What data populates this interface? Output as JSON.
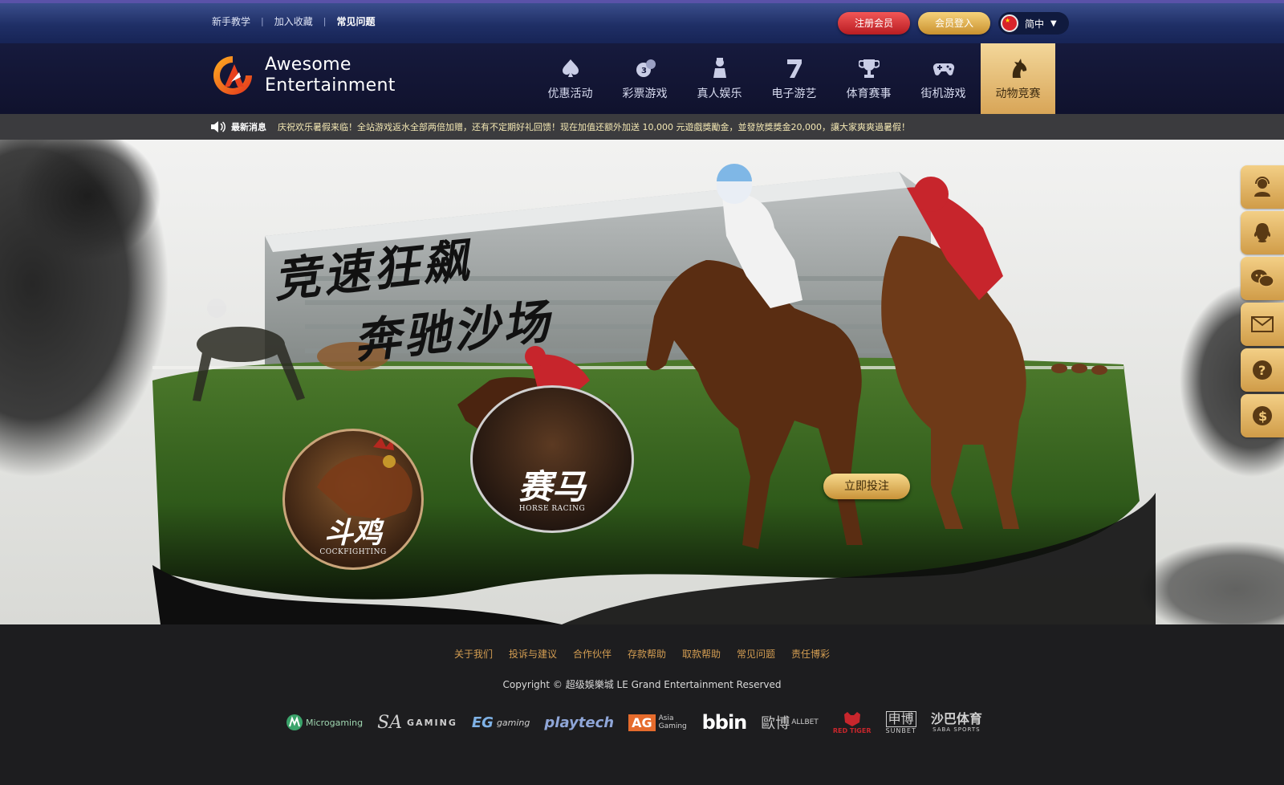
{
  "topbar": {
    "links": [
      "新手教学",
      "加入收藏",
      "常见问题"
    ],
    "separator": "|",
    "register_label": "注册会员",
    "login_label": "会员登入",
    "language_label": "简中"
  },
  "header": {
    "brand_line1": "Awesome",
    "brand_line2": "Entertainment",
    "nav": [
      {
        "label": "优惠活动",
        "icon": "spade-icon"
      },
      {
        "label": "彩票游戏",
        "icon": "lottery-balls-icon"
      },
      {
        "label": "真人娱乐",
        "icon": "dealer-icon"
      },
      {
        "label": "电子游艺",
        "icon": "slot-seven-icon"
      },
      {
        "label": "体育赛事",
        "icon": "trophy-icon"
      },
      {
        "label": "街机游戏",
        "icon": "gamepad-icon"
      },
      {
        "label": "动物竞赛",
        "icon": "horse-head-icon",
        "active": true
      }
    ]
  },
  "ticker": {
    "label": "最新消息",
    "text": "庆祝欢乐暑假来临！全站游戏返水全部两倍加赠，还有不定期好礼回馈！现在加值还额外加送 10,000 元遊戲獎勵金，並發放獎獎金20,000，讓大家爽爽過暑假！"
  },
  "hero": {
    "slogan_line1": "竞速狂飙",
    "slogan_line2": "奔驰沙场",
    "cockfighting_cn": "斗鸡",
    "cockfighting_en": "COCKFIGHTING",
    "horseracing_cn": "赛马",
    "horseracing_en": "HORSE RACING",
    "bet_label": "立即投注"
  },
  "floatbar": {
    "items": [
      "customer-service-icon",
      "qq-icon",
      "wechat-icon",
      "mail-icon",
      "help-icon",
      "dollar-icon"
    ]
  },
  "footer": {
    "links": [
      "关于我们",
      "投诉与建议",
      "合作伙伴",
      "存款帮助",
      "取款帮助",
      "常见问题",
      "责任博彩"
    ],
    "copyright": "Copyright © 超级娛樂城 LE Grand Entertainment Reserved",
    "partners": [
      "Microgaming",
      "GAMING",
      "gaming",
      "playtech",
      "AG",
      "Asia Gaming",
      "bbin",
      "歐博",
      "ALLBET",
      "RED TIGER",
      "申博",
      "SUNBET",
      "沙巴体育",
      "SABA SPORTS"
    ]
  },
  "colors": {
    "gold": "#d8a557",
    "navy": "#161a3d",
    "register_red": "#d02a2e",
    "footer_link": "#d39d52"
  }
}
